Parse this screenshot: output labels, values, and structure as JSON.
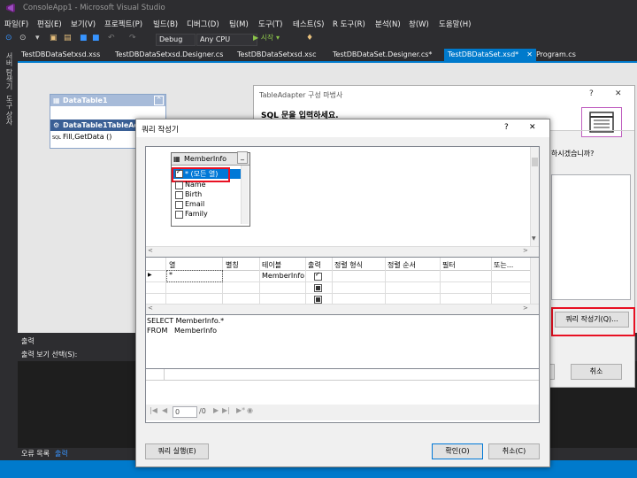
{
  "window": {
    "title": "ConsoleApp1 - Microsoft Visual Studio"
  },
  "menu": [
    "파일(F)",
    "편집(E)",
    "보기(V)",
    "프로젝트(P)",
    "빌드(B)",
    "디버그(D)",
    "팀(M)",
    "도구(T)",
    "테스트(S)",
    "R 도구(R)",
    "분석(N)",
    "창(W)",
    "도움말(H)"
  ],
  "toolbar": {
    "config": "Debug",
    "platform": "Any CPU",
    "start_label": "▶ 시작 ▾"
  },
  "tabs": [
    {
      "label": "TestDBDataSetxsd.xss",
      "active": false
    },
    {
      "label": "TestDBDataSetxsd.Designer.cs",
      "active": false
    },
    {
      "label": "TestDBDataSetxsd.xsc",
      "active": false
    },
    {
      "label": "TestDBDataSet.Designer.cs*",
      "active": false
    },
    {
      "label": "TestDBDataSet.xsd*",
      "active": true
    },
    {
      "label": "Program.cs",
      "active": false
    }
  ],
  "left_rail": {
    "item1": "서버 탐색기",
    "item2": "도구 상자"
  },
  "designer": {
    "datatable_title": "DataTable1",
    "adapter_title": "DataTable1TableAdap",
    "adapter_method": "Fill,GetData ()",
    "sql_tag": "SQL"
  },
  "output": {
    "title": "출력",
    "source_label": "출력 보기 선택(S):",
    "bottom_tabs": [
      "오류 목록",
      "출력"
    ]
  },
  "wizard": {
    "title": "TableAdapter 구성 마법사",
    "heading": "SQL 문을 입력하세요.",
    "question_partial": "하시겠습니까?",
    "query_builder_button": "쿼리 작성기(Q)...",
    "cancel_button": "취소",
    "help": "?",
    "close": "✕"
  },
  "qb": {
    "title": "쿼리 작성기",
    "help": "?",
    "close": "✕",
    "table": {
      "name": "MemberInfo",
      "min": "_",
      "columns": [
        "* (모든 열)",
        "Name",
        "Birth",
        "Email",
        "Family"
      ]
    },
    "grid_headers": [
      "열",
      "별칭",
      "테이블",
      "출력",
      "정렬 형식",
      "정렬 순서",
      "필터",
      "또는..."
    ],
    "grid_row": {
      "column": "*",
      "table": "MemberInfo"
    },
    "sql_line1": "SELECT MemberInfo.*",
    "sql_line2": "FROM   MemberInfo",
    "nav_page": "0",
    "nav_total": "/0",
    "execute_button": "쿼리 실행(E)",
    "ok_button": "확인(O)",
    "cancel_button": "취소(C)"
  },
  "colors": {
    "accent": "#007acc",
    "highlight_red": "#e81123",
    "selection": "#0078d7"
  }
}
